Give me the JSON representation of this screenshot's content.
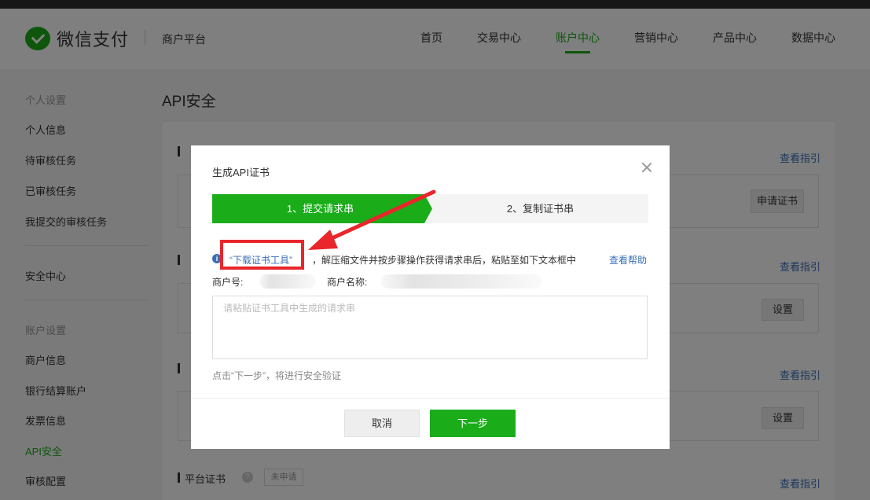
{
  "header": {
    "brand": "微信支付",
    "platform": "商户平台",
    "nav": [
      "首页",
      "交易中心",
      "账户中心",
      "营销中心",
      "产品中心",
      "数据中心"
    ],
    "active_nav": "账户中心"
  },
  "sidebar": {
    "group_personal": "个人设置",
    "items_personal": [
      "个人信息",
      "待审核任务",
      "已审核任务",
      "我提交的审核任务"
    ],
    "security_center": "安全中心",
    "group_account": "账户设置",
    "items_account": [
      "商户信息",
      "银行结算账户",
      "发票信息",
      "API安全",
      "审核配置"
    ],
    "active_item": "API安全"
  },
  "main": {
    "page_title": "API安全",
    "guide_link": "查看指引",
    "apply_cert_button": "申请证书",
    "setup_button": "设置",
    "platform_cert_title": "平台证书",
    "platform_cert_status": "未申请",
    "help_icon": "?"
  },
  "modal": {
    "title": "生成API证书",
    "close_icon": "close-icon",
    "steps": [
      "1、提交请求串",
      "2、复制证书串"
    ],
    "info_icon": "i",
    "download_link": "“下载证书工具”",
    "info_text": "，解压缩文件并按步骤操作获得请求串后，粘贴至如下文本框中",
    "help_link": "查看帮助",
    "merchant_no_label": "商户号:",
    "merchant_name_label": "商户名称:",
    "textarea_placeholder": "请粘贴证书工具中生成的请求串",
    "hint": "点击“下一步”，将进行安全验证",
    "cancel_button": "取消",
    "next_button": "下一步"
  },
  "colors": {
    "brand_green": "#1aad19",
    "link_blue": "#3a6fb7",
    "annotation_red": "#e8262b"
  }
}
